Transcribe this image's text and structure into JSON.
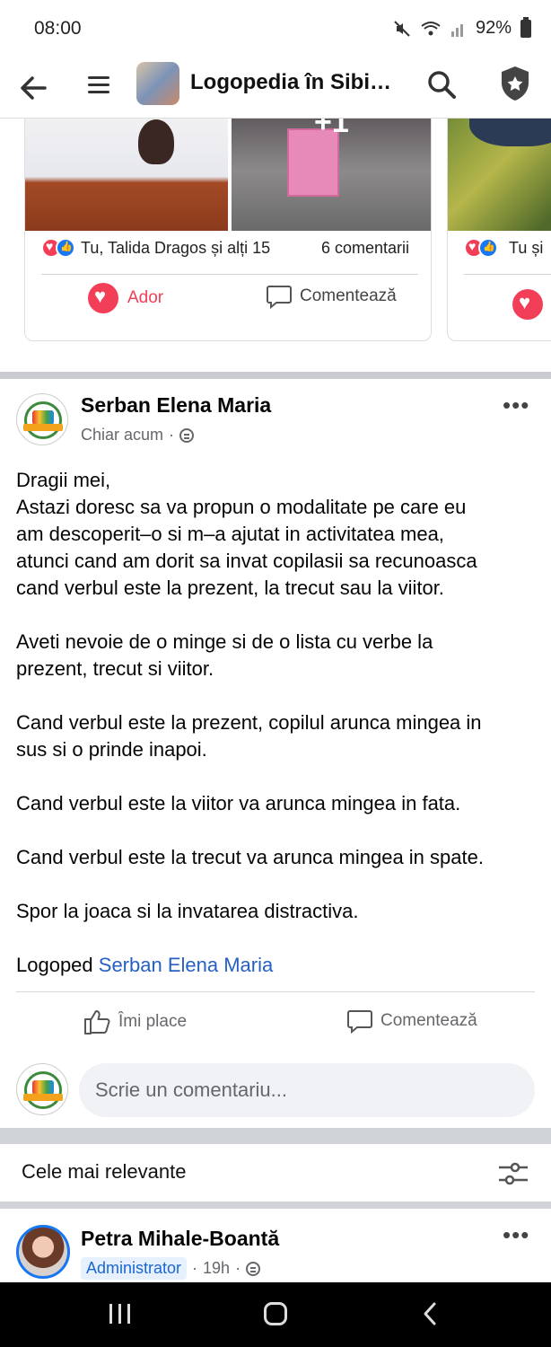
{
  "status_bar": {
    "time": "08:00",
    "battery": "92%"
  },
  "header": {
    "title": "Logopedia în Sibiu..."
  },
  "carousel": {
    "main_card": {
      "plus_overlay": "+1",
      "reactions_text": "Tu, Talida Dragos și alți 15",
      "comments_text": "6 comentarii",
      "love_label": "Ador",
      "comment_label": "Comentează"
    },
    "right_card": {
      "reactions_text": "Tu și"
    }
  },
  "post": {
    "author": "Serban Elena Maria",
    "time": "Chiar acum",
    "body": {
      "p1_l1": "Dragii mei,",
      "p1_l2": "Astazi doresc sa va propun o modalitate pe care eu",
      "p1_l3": "am descoperit–o si m–a ajutat in activitatea mea,",
      "p1_l4": "atunci cand am dorit sa invat copilasii sa recunoasca",
      "p1_l5": "cand verbul este la prezent, la trecut sau la viitor.",
      "p2_l1": "Aveti nevoie de o minge si de o lista cu verbe la",
      "p2_l2": "prezent, trecut si viitor.",
      "p3_l1": "Cand verbul este la prezent, copilul arunca mingea in",
      "p3_l2": "sus si o prinde inapoi.",
      "p4": "Cand verbul este la viitor va arunca mingea in fata.",
      "p5": "Cand verbul este la trecut va arunca mingea in spate.",
      "p6": "Spor la joaca si la invatarea distractiva.",
      "signature_prefix": "Logoped ",
      "signature_link": "Serban Elena Maria"
    },
    "like_label": "Îmi place",
    "comment_label": "Comentează",
    "comment_placeholder": "Scrie un comentariu..."
  },
  "comments_filter": {
    "label": "Cele mai relevante"
  },
  "comment": {
    "author": "Petra Mihale-Boantă",
    "badge": "Administrator",
    "time": "19h"
  },
  "colors": {
    "accent_blue": "#1877f2",
    "love_red": "#f33e58",
    "link_blue": "#2660c4"
  }
}
